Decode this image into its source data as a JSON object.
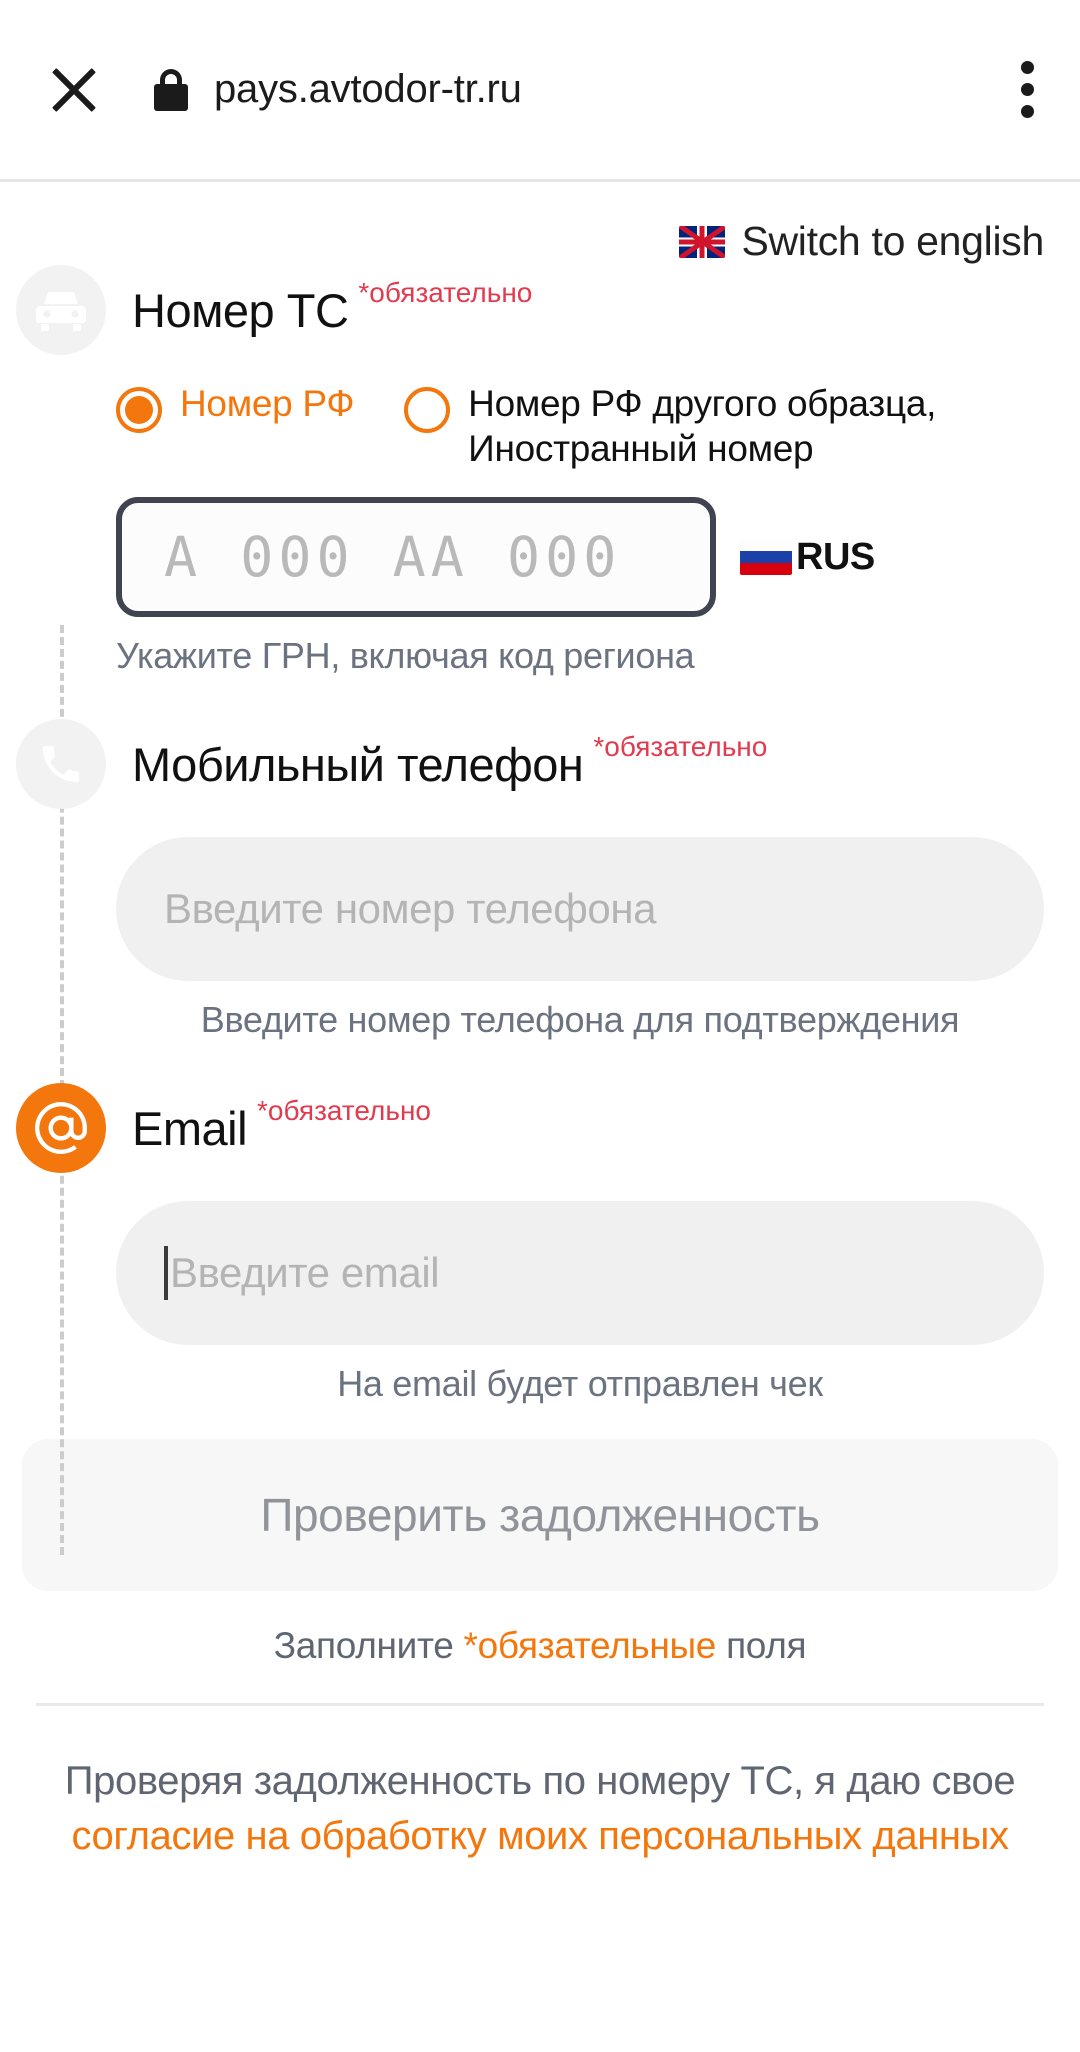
{
  "browser": {
    "close_icon": "close-icon",
    "lock_icon": "lock-icon",
    "url": "pays.avtodor-tr.ru",
    "menu_icon": "kebab-menu-icon"
  },
  "lang_switch": {
    "flag": "uk-flag-icon",
    "label": "Switch to english"
  },
  "required_mark": "*обязательно",
  "sections": {
    "vehicle": {
      "icon": "car-icon",
      "title": "Номер ТС",
      "required": "*обязательно",
      "radios": [
        {
          "label": "Номер РФ",
          "checked": true
        },
        {
          "label": "Номер РФ другого образца, Иностранный номер",
          "checked": false
        }
      ],
      "plate_placeholder": "A 000 AA 000",
      "country_badge": "RUS",
      "country_flag": "ru-flag-icon",
      "hint": "Укажите ГРН, включая код региона"
    },
    "phone": {
      "icon": "phone-icon",
      "title": "Мобильный телефон",
      "required": "*обязательно",
      "placeholder": "Введите номер телефона",
      "value": "",
      "hint": "Введите номер телефона для подтверждения"
    },
    "email": {
      "icon": "at-icon",
      "title": "Email",
      "required": "*обязательно",
      "placeholder": "Введите email",
      "value": "",
      "focused": true,
      "hint": "На email будет отправлен чек"
    }
  },
  "submit": {
    "label": "Проверить задолженность",
    "disabled": true
  },
  "fill_note": {
    "before": "Заполните",
    "accent": "*обязательные",
    "after": "поля"
  },
  "consent": {
    "line1": "Проверяя задолженность по номеру ТС, я даю свое",
    "link": "согласие на обработку моих персональных данных"
  },
  "colors": {
    "accent": "#f3770d",
    "required_red": "#e23a4e",
    "plate_border": "#3f4450",
    "muted_text": "#6b7280",
    "field_bg": "#f0f0f0"
  }
}
